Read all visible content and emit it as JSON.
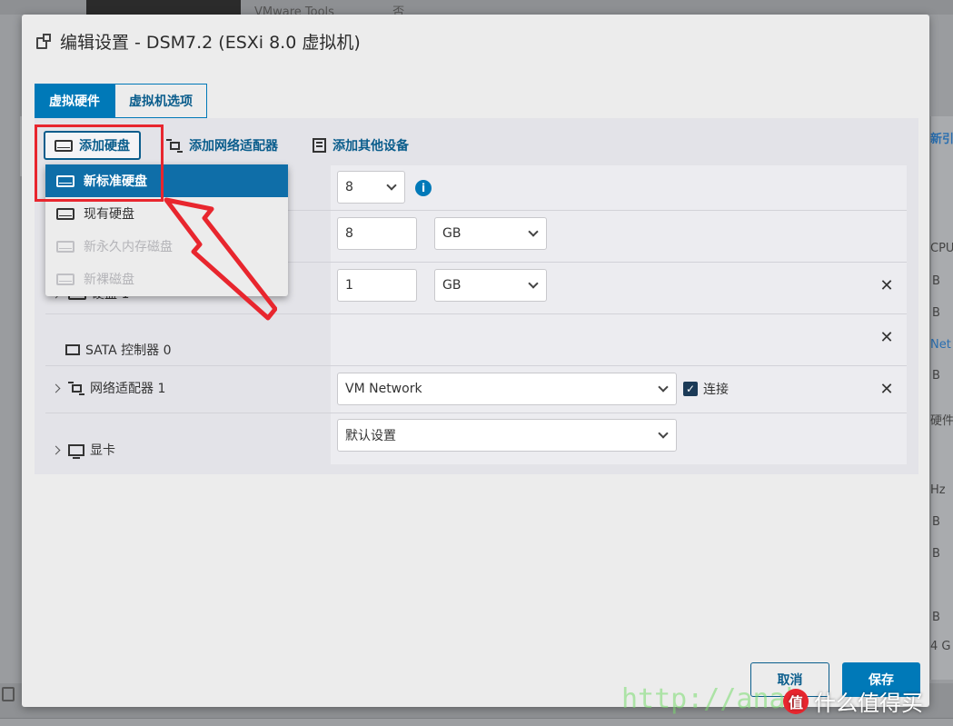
{
  "background": {
    "top_text": "VMware Tools",
    "top_value": "否",
    "right_column": [
      "新引",
      "CPU",
      "B",
      "B",
      "Net",
      "B",
      "硬件",
      "Hz",
      "B",
      "B",
      "B",
      "4 G"
    ]
  },
  "dialog": {
    "title": "编辑设置 - DSM7.2 (ESXi 8.0 虚拟机)",
    "tabs": [
      {
        "label": "虚拟硬件",
        "active": true
      },
      {
        "label": "虚拟机选项",
        "active": false
      }
    ],
    "toolbar": {
      "add_disk": "添加硬盘",
      "add_network": "添加网络适配器",
      "add_other": "添加其他设备"
    },
    "add_disk_menu": [
      {
        "label": "新标准硬盘",
        "state": "selected"
      },
      {
        "label": "现有硬盘",
        "state": "enabled"
      },
      {
        "label": "新永久内存磁盘",
        "state": "disabled"
      },
      {
        "label": "新裸磁盘",
        "state": "disabled"
      }
    ],
    "rows": {
      "cpu": {
        "value": "8",
        "info": "i"
      },
      "memory": {
        "value": "8",
        "unit": "GB"
      },
      "disk": {
        "label": "硬盘 1",
        "value": "1",
        "unit": "GB",
        "remove": "✕"
      },
      "sata": {
        "label": "SATA 控制器 0",
        "remove": "✕"
      },
      "network": {
        "label": "网络适配器 1",
        "value": "VM Network",
        "connect_label": "连接",
        "connected": true,
        "remove": "✕"
      },
      "display": {
        "label": "显卡",
        "value": "默认设置"
      }
    },
    "buttons": {
      "cancel": "取消",
      "save": "保存"
    }
  },
  "watermark": {
    "url_text": "http://anah",
    "site": "什么值得买",
    "badge": "值"
  },
  "colors": {
    "accent": "#0079b8",
    "annotation_red": "#e8262e"
  }
}
